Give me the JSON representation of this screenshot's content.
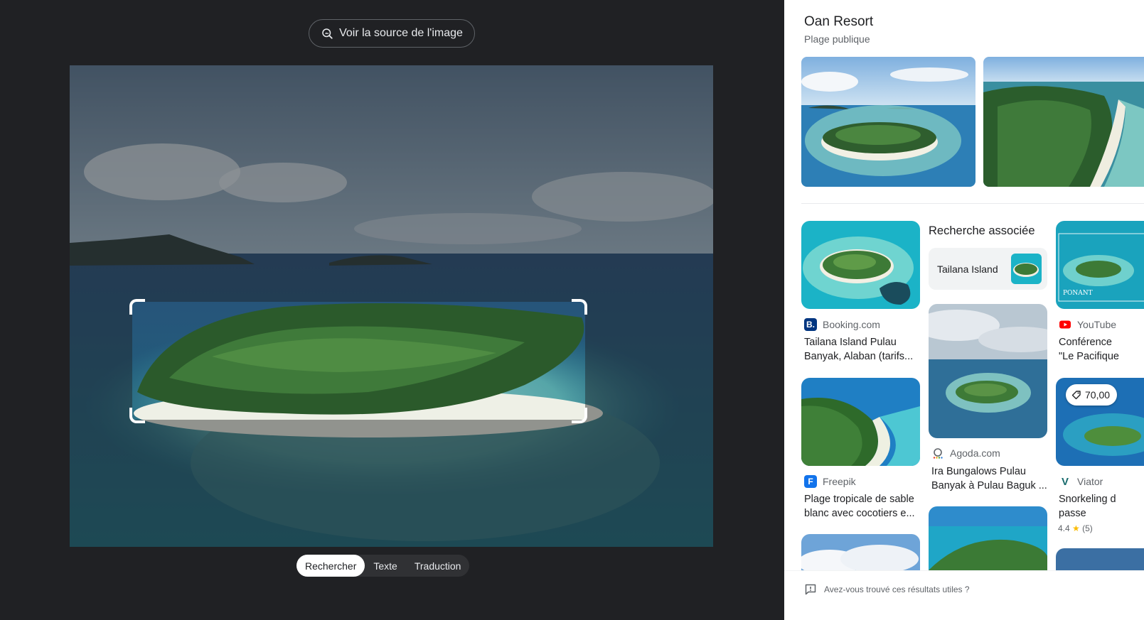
{
  "viewer": {
    "source_button_label": "Voir la source de l'image",
    "modes": [
      {
        "label": "Rechercher",
        "active": true
      },
      {
        "label": "Texte",
        "active": false
      },
      {
        "label": "Traduction",
        "active": false
      }
    ]
  },
  "panel": {
    "title": "Oan Resort",
    "subtitle": "Plage publique",
    "related": {
      "heading": "Recherche associée",
      "chip_label": "Tailana Island"
    },
    "results": [
      {
        "source": "Booking.com",
        "title_line1": "Tailana Island Pulau",
        "title_line2": "Banyak, Alaban (tarifs...",
        "logo_letter": "B.",
        "logo_color": "#003580"
      },
      {
        "source": "Freepik",
        "title_line1": "Plage tropicale de sable",
        "title_line2": "blanc avec cocotiers e...",
        "logo_letter": "F",
        "logo_color": "#1273eb"
      },
      {
        "source": "Agoda.com",
        "title_line1": "Ira Bungalows Pulau",
        "title_line2": "Banyak à Pulau Baguk ...",
        "logo_letter": "",
        "logo_color": "#5f6368"
      },
      {
        "source": "YouTube",
        "title_line1": "Conférence",
        "title_line2": "\"Le Pacifique",
        "logo_letter": "▶",
        "logo_color": "#ff0000"
      },
      {
        "source": "Viator",
        "title_line1": "Snorkeling d",
        "title_line2": "passe",
        "logo_letter": "V",
        "logo_color": "#186b6d"
      }
    ],
    "price_tag": "70,00",
    "rating_value": "4.4",
    "rating_star": "★",
    "rating_count": "(5)",
    "watermark": "PONANT",
    "feedback_label": "Avez-vous trouvé ces résultats utiles ?"
  },
  "colors": {
    "viewer_bg": "#202124",
    "panel_bg": "#ffffff",
    "chip_bg": "#f1f3f4"
  }
}
